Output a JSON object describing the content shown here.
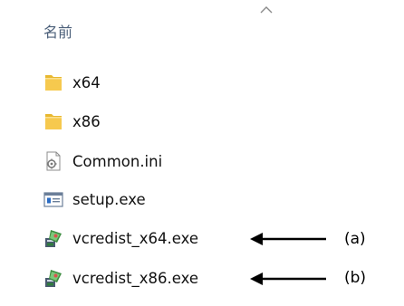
{
  "header": {
    "name_column": "名前"
  },
  "files": [
    {
      "label": "x64",
      "icon": "folder-icon"
    },
    {
      "label": "x86",
      "icon": "folder-icon"
    },
    {
      "label": "Common.ini",
      "icon": "settings-file-icon"
    },
    {
      "label": "setup.exe",
      "icon": "application-window-icon"
    },
    {
      "label": "vcredist_x64.exe",
      "icon": "installer-icon"
    },
    {
      "label": "vcredist_x86.exe",
      "icon": "installer-icon"
    }
  ],
  "annotations": {
    "a": "(a)",
    "b": "(b)"
  },
  "colors": {
    "folder": "#f4c64a",
    "header_text": "#4c607a",
    "arrow": "#000000"
  }
}
